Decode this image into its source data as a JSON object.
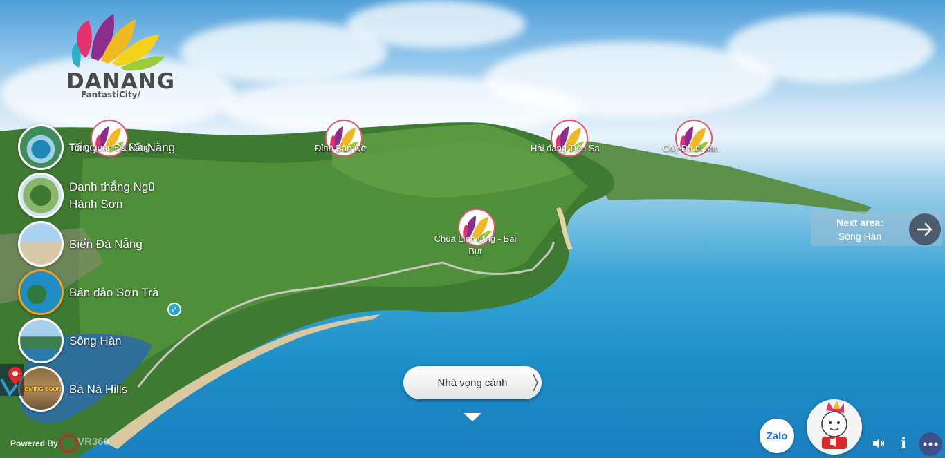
{
  "logo": {
    "brand": "DANANG",
    "tagline": "FantastiCity/"
  },
  "scenes": [
    {
      "label": "Tổng quan Đà Nẵng",
      "thumb_icon": "aerial-city-icon",
      "active": false
    },
    {
      "label": "Danh thắng Ngũ Hành Sơn",
      "thumb_icon": "marble-mountains-icon",
      "active": false
    },
    {
      "label": "Biển Đà Nẵng",
      "thumb_icon": "beach-icon",
      "active": false
    },
    {
      "label": "Bán đảo Sơn Trà",
      "thumb_icon": "peninsula-icon",
      "active": true
    },
    {
      "label": "Sông Hàn",
      "thumb_icon": "river-icon",
      "active": false
    },
    {
      "label": "Bà Nà Hills",
      "thumb_icon": "coming-soon-icon",
      "active": false,
      "badge": "COMING SOON"
    }
  ],
  "hotspots": [
    {
      "label": "Tổng quan Đà Nẵng"
    },
    {
      "label": "Đỉnh Bàn Cờ"
    },
    {
      "label": "Hải đăng Tiên Sa"
    },
    {
      "label": "Cây Đa di sản"
    },
    {
      "label": "Chùa Linh Ứng - Bãi Bụt"
    }
  ],
  "next_area": {
    "title": "Next area:",
    "name": "Sông Hàn"
  },
  "viewpoint": {
    "label": "Nhà vọng cảnh"
  },
  "footer": {
    "powered_by": "Powered By",
    "brand": "VR360"
  },
  "controls": {
    "zalo": "Zalo",
    "info": "i"
  },
  "colors": {
    "accent": "#f3a21b",
    "more_button": "#3e4f8a",
    "next_button": "#4a5d6e",
    "zalo_blue": "#0a78e8"
  }
}
